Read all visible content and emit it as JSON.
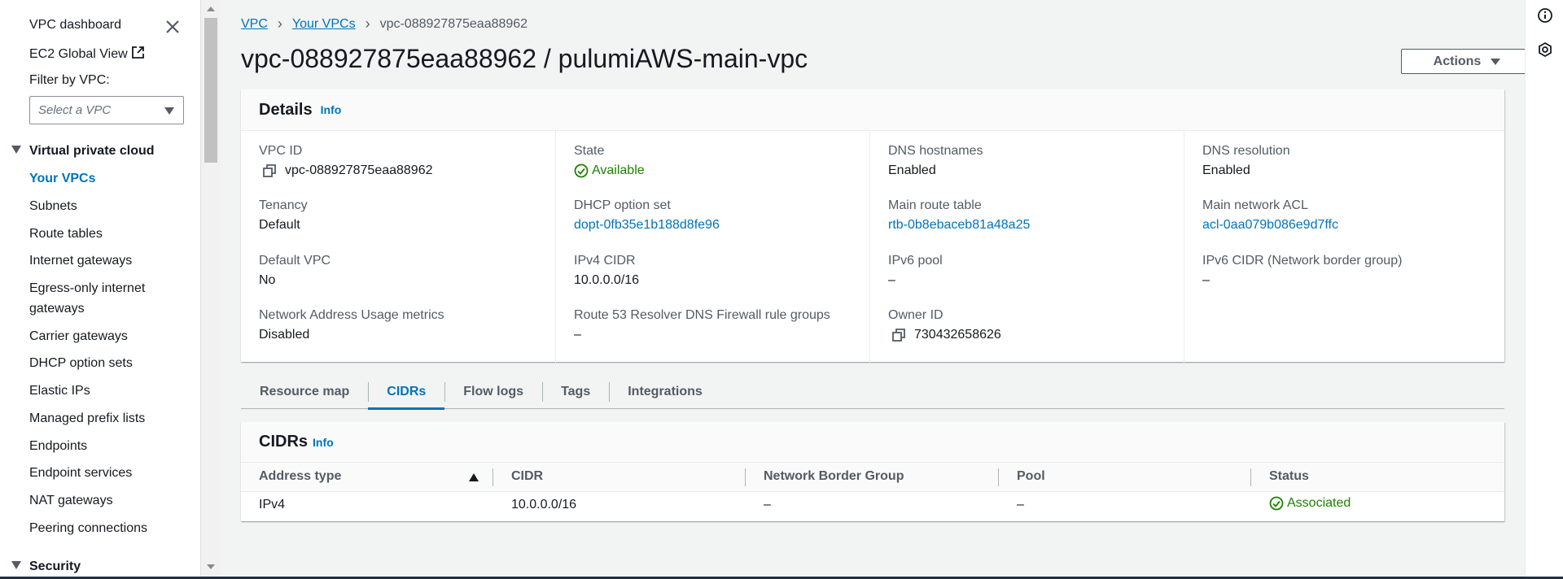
{
  "sidebar": {
    "dashboard": "VPC dashboard",
    "ec2_global_view": "EC2 Global View",
    "filter_label": "Filter by VPC:",
    "filter_placeholder": "Select a VPC",
    "section_vpc": "Virtual private cloud",
    "items": [
      "Your VPCs",
      "Subnets",
      "Route tables",
      "Internet gateways",
      "Egress-only internet",
      "gateways",
      "Carrier gateways",
      "DHCP option sets",
      "Elastic IPs",
      "Managed prefix lists",
      "Endpoints",
      "Endpoint services",
      "NAT gateways",
      "Peering connections"
    ],
    "section_security": "Security"
  },
  "breadcrumb": {
    "root": "VPC",
    "parent": "Your VPCs",
    "current": "vpc-088927875eaa88962"
  },
  "page_title": "vpc-088927875eaa88962 / pulumiAWS-main-vpc",
  "actions_label": "Actions",
  "details": {
    "title": "Details",
    "info": "Info",
    "fields": {
      "vpc_id": {
        "label": "VPC ID",
        "value": "vpc-088927875eaa88962"
      },
      "state": {
        "label": "State",
        "value": "Available"
      },
      "dns_hostnames": {
        "label": "DNS hostnames",
        "value": "Enabled"
      },
      "dns_resolution": {
        "label": "DNS resolution",
        "value": "Enabled"
      },
      "tenancy": {
        "label": "Tenancy",
        "value": "Default"
      },
      "dhcp_option_set": {
        "label": "DHCP option set",
        "value": "dopt-0fb35e1b188d8fe96"
      },
      "main_route_table": {
        "label": "Main route table",
        "value": "rtb-0b8ebaceb81a48a25"
      },
      "main_network_acl": {
        "label": "Main network ACL",
        "value": "acl-0aa079b086e9d7ffc"
      },
      "default_vpc": {
        "label": "Default VPC",
        "value": "No"
      },
      "ipv4_cidr": {
        "label": "IPv4 CIDR",
        "value": "10.0.0.0/16"
      },
      "ipv6_pool": {
        "label": "IPv6 pool",
        "value": "–"
      },
      "ipv6_cidr": {
        "label": "IPv6 CIDR (Network border group)",
        "value": "–"
      },
      "nau_metrics": {
        "label": "Network Address Usage metrics",
        "value": "Disabled"
      },
      "route53": {
        "label": "Route 53 Resolver DNS Firewall rule groups",
        "value": "–"
      },
      "owner_id": {
        "label": "Owner ID",
        "value": "730432658626"
      }
    }
  },
  "tabs": [
    "Resource map",
    "CIDRs",
    "Flow logs",
    "Tags",
    "Integrations"
  ],
  "active_tab": "CIDRs",
  "cidrs": {
    "title": "CIDRs",
    "info": "Info",
    "columns": [
      "Address type",
      "CIDR",
      "Network Border Group",
      "Pool",
      "Status"
    ],
    "rows": [
      [
        "IPv4",
        "10.0.0.0/16",
        "–",
        "–",
        "Associated"
      ]
    ]
  },
  "colors": {
    "link": "#0073bb",
    "success": "#1d8102",
    "text": "#16191f",
    "muted": "#545b64"
  },
  "icons": [
    "close-icon",
    "external-link-icon",
    "copy-icon",
    "status-check-icon",
    "info-circle-icon",
    "settings-hex-icon"
  ]
}
